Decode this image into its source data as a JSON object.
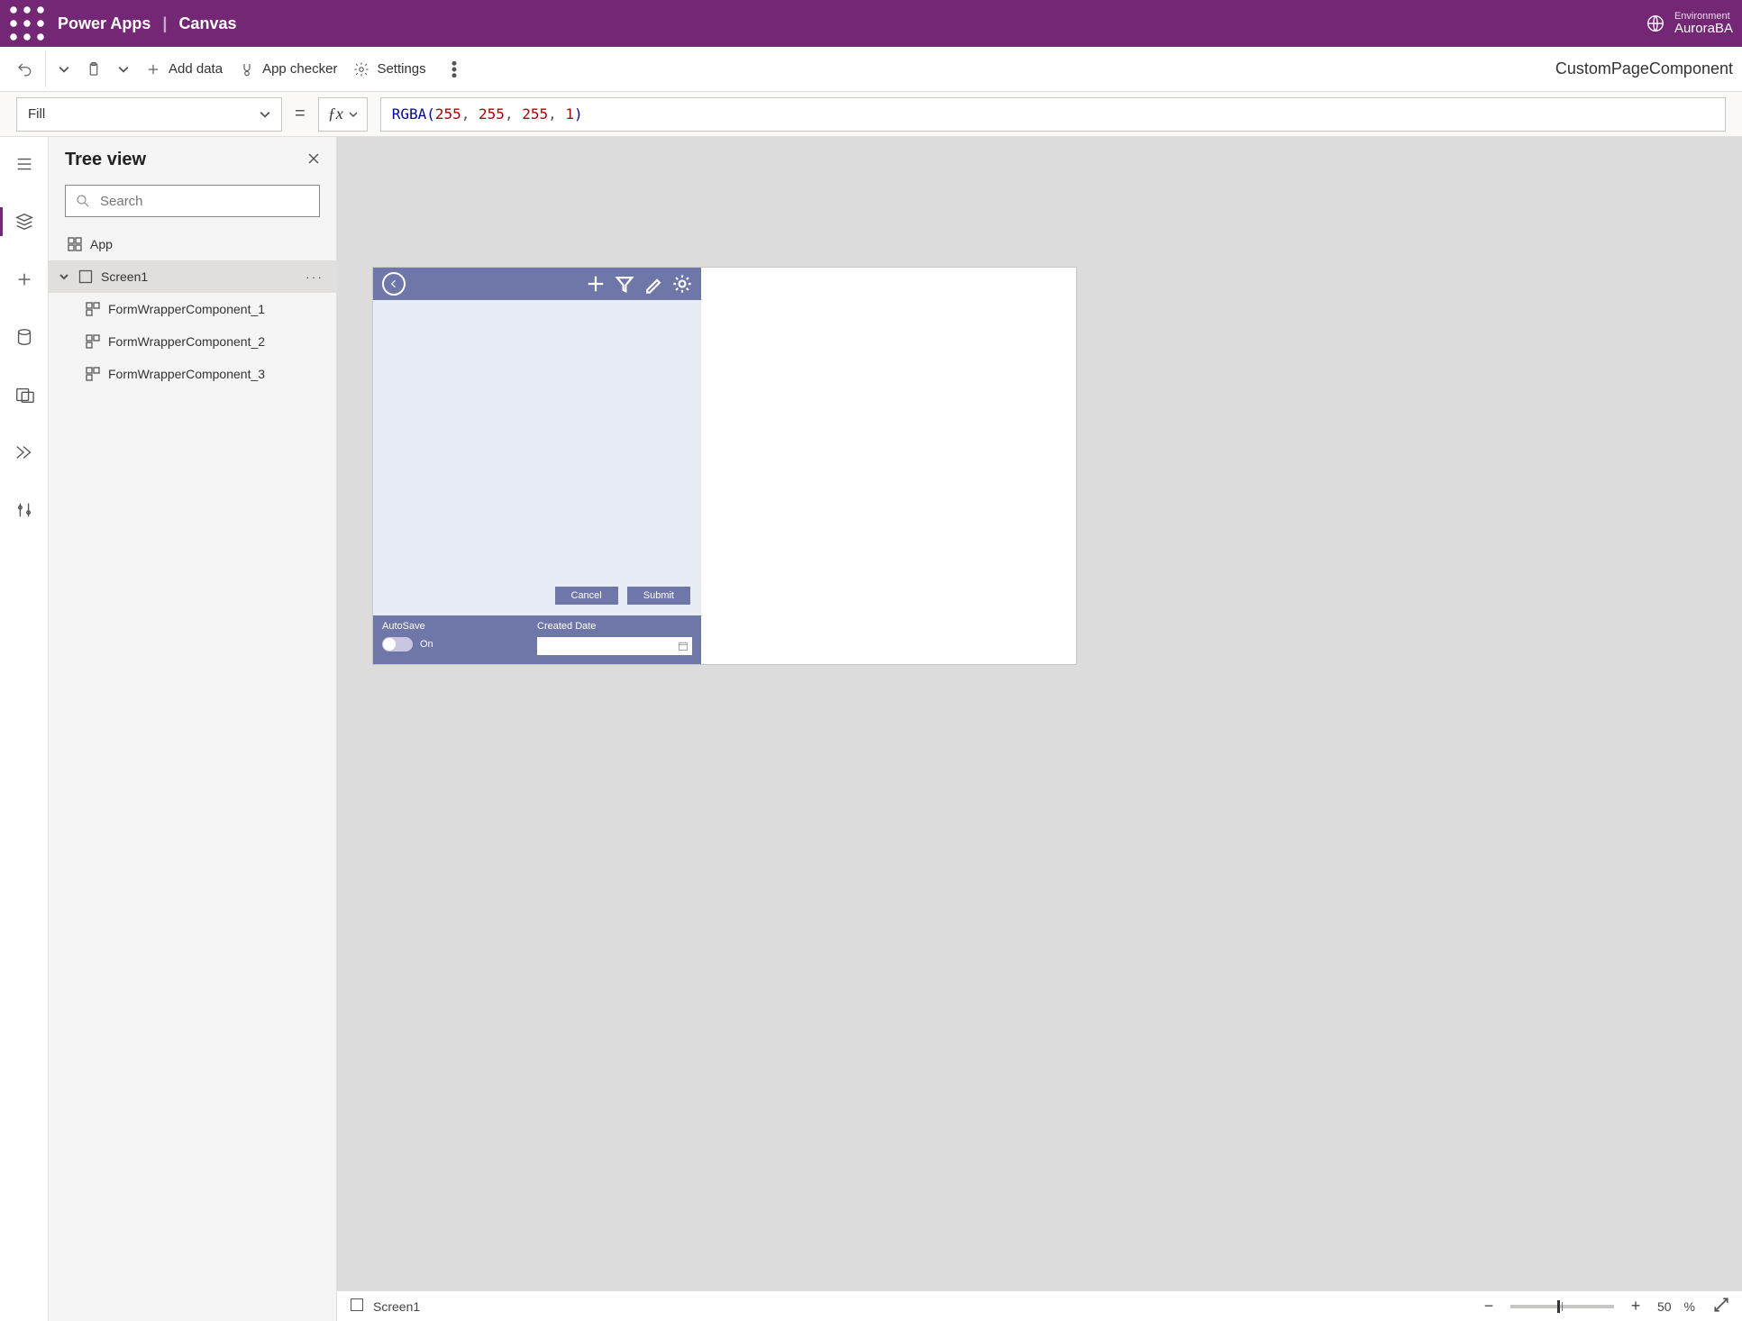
{
  "header": {
    "app_name": "Power Apps",
    "separator": "|",
    "mode": "Canvas",
    "env_label": "Environment",
    "env_name": "AuroraBA"
  },
  "commandbar": {
    "add_data": "Add data",
    "app_checker": "App checker",
    "settings": "Settings",
    "right_title": "CustomPageComponent"
  },
  "formula": {
    "property": "Fill",
    "fn": "RGBA",
    "args": [
      "255",
      "255",
      "255",
      "1"
    ]
  },
  "tree": {
    "title": "Tree view",
    "search_placeholder": "Search",
    "app_label": "App",
    "screen_label": "Screen1",
    "children": [
      "FormWrapperComponent_1",
      "FormWrapperComponent_2",
      "FormWrapperComponent_3"
    ]
  },
  "canvas_component": {
    "cancel": "Cancel",
    "submit": "Submit",
    "autosave_label": "AutoSave",
    "autosave_state": "On",
    "created_label": "Created Date"
  },
  "status": {
    "screen_name": "Screen1",
    "zoom_value": "50",
    "zoom_unit": "%"
  }
}
